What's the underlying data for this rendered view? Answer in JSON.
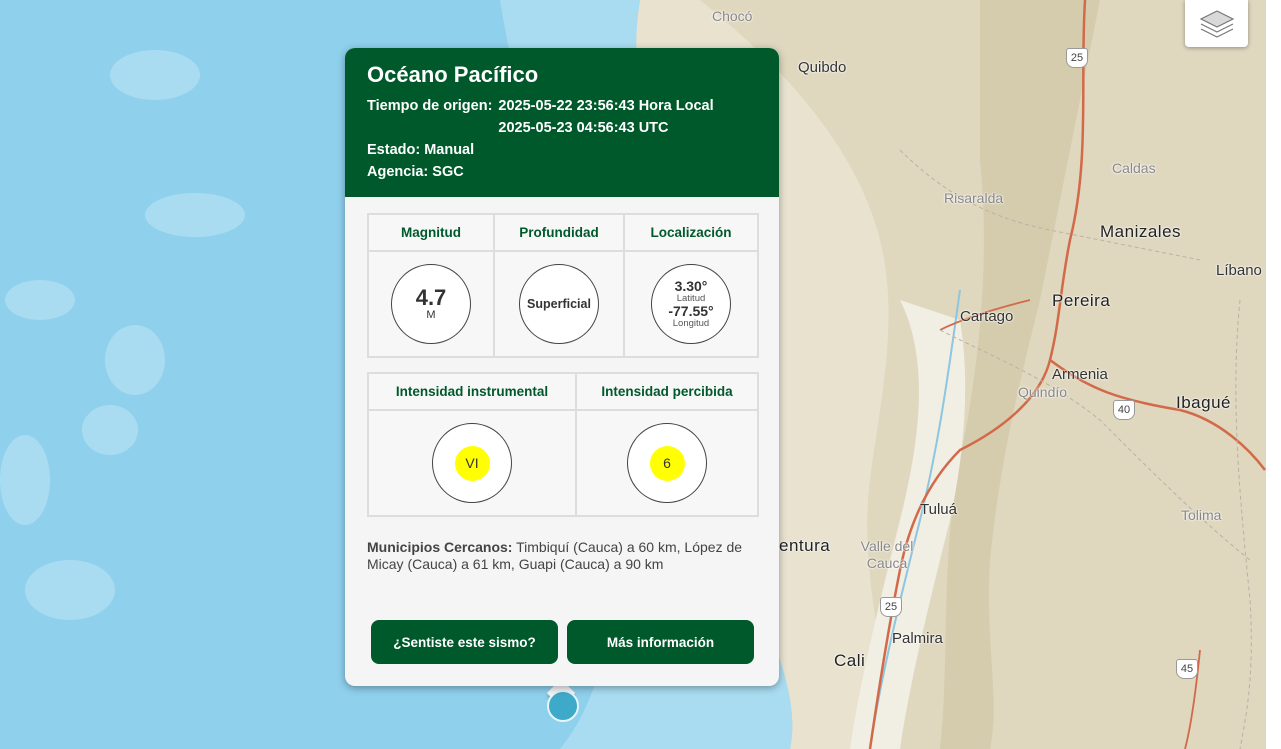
{
  "map": {
    "places": [
      {
        "name": "Chocó",
        "kind": "region"
      },
      {
        "name": "Quibdo",
        "kind": "town"
      },
      {
        "name": "Caldas",
        "kind": "region"
      },
      {
        "name": "Risaralda",
        "kind": "region"
      },
      {
        "name": "Manizales",
        "kind": "city"
      },
      {
        "name": "Líbano",
        "kind": "town"
      },
      {
        "name": "Pereira",
        "kind": "city"
      },
      {
        "name": "Cartago",
        "kind": "town"
      },
      {
        "name": "Armenia",
        "kind": "town"
      },
      {
        "name": "Quindío",
        "kind": "region"
      },
      {
        "name": "Ibagué",
        "kind": "city"
      },
      {
        "name": "Tuluá",
        "kind": "town"
      },
      {
        "name": "Tolima",
        "kind": "region"
      },
      {
        "name": "entura",
        "kind": "city"
      },
      {
        "name": "Valle del Cauca",
        "kind": "region"
      },
      {
        "name": "Palmira",
        "kind": "town"
      },
      {
        "name": "Cali",
        "kind": "city"
      }
    ],
    "shields": [
      "25",
      "40",
      "25",
      "45"
    ],
    "layers_icon": "layers-icon"
  },
  "popup": {
    "title": "Océano Pacífico",
    "origin_label": "Tiempo de origen:",
    "local_time": "2025-05-22 23:56:43 Hora Local",
    "utc_time": "2025-05-23 04:56:43 UTC",
    "status_label": "Estado:",
    "status_value": "Manual",
    "agency_label": "Agencia:",
    "agency_value": "SGC",
    "magnitude": {
      "header": "Magnitud",
      "value": "4.7",
      "unit": "M"
    },
    "depth": {
      "header": "Profundidad",
      "value": "Superficial"
    },
    "location": {
      "header": "Localización",
      "lat": "3.30°",
      "lat_label": "Latitud",
      "lon": "-77.55°",
      "lon_label": "Longitud"
    },
    "instrumental": {
      "header": "Intensidad instrumental",
      "value": "VI"
    },
    "perceived": {
      "header": "Intensidad percibida",
      "value": "6"
    },
    "nearby_label": "Municipios Cercanos:",
    "nearby_text": "Timbiquí (Cauca) a 60 km, López de Micay (Cauca) a 61 km, Guapi (Cauca) a 90 km",
    "btn_felt": "¿Sentiste este sismo?",
    "btn_more": "Más información"
  },
  "colors": {
    "brand_green": "#00592b",
    "intensity_yellow": "#ffff00",
    "ocean": "#8fd0ec",
    "marker": "#3fa9c9"
  }
}
